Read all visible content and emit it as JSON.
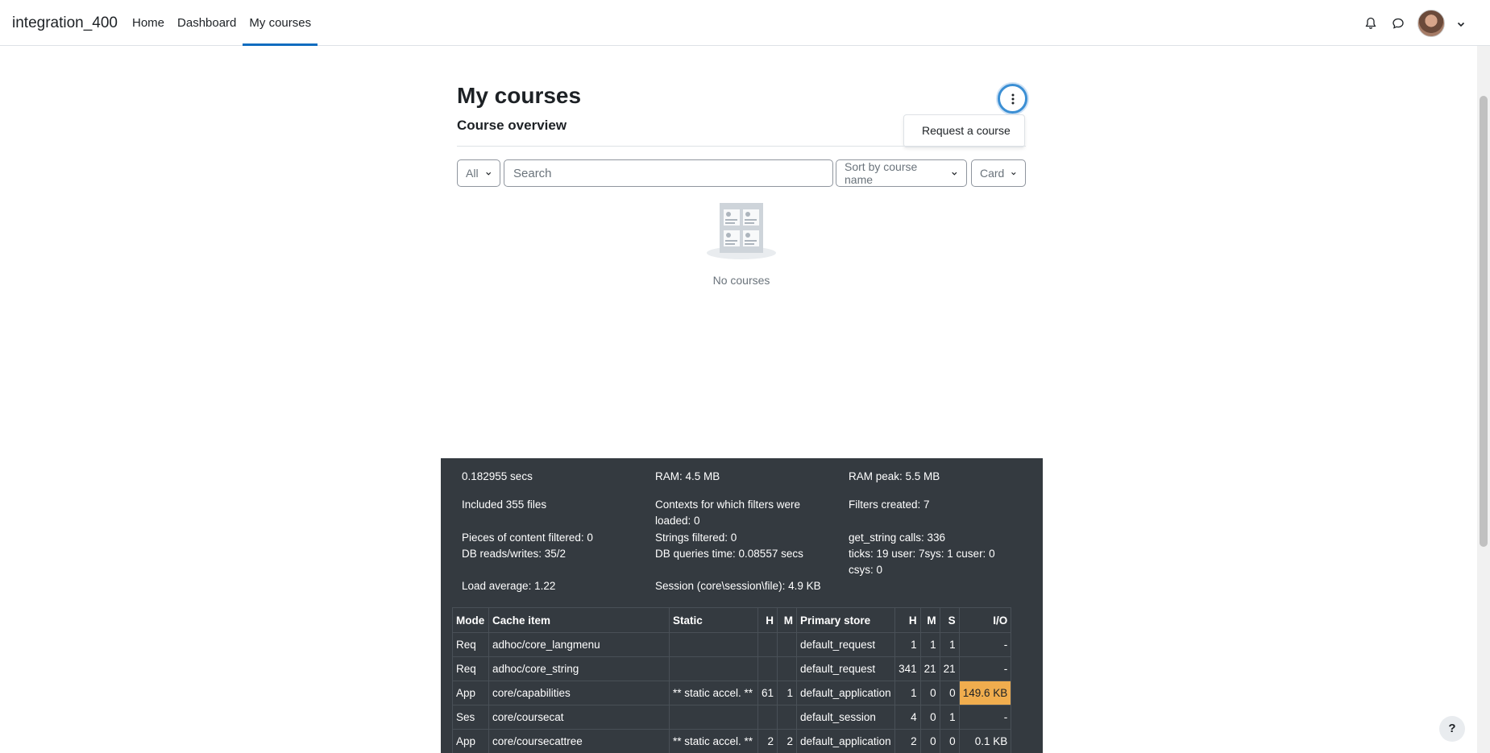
{
  "navbar": {
    "brand": "integration_400",
    "links": [
      {
        "label": "Home"
      },
      {
        "label": "Dashboard"
      },
      {
        "label": "My courses",
        "active": true
      }
    ]
  },
  "main": {
    "title": "My courses",
    "section_title": "Course overview",
    "actions_menu": {
      "item": "Request a course"
    },
    "filters": {
      "grouping": "All",
      "search_placeholder": "Search",
      "sort": "Sort by course name",
      "view": "Card"
    },
    "empty_text": "No courses"
  },
  "perf": {
    "row1": [
      "0.182955 secs",
      "RAM: 4.5 MB",
      "RAM peak: 5.5 MB"
    ],
    "included": "Included 355 files",
    "contexts": "Contexts for which filters were loaded: 0",
    "filters_created": "Filters created: 7",
    "pieces": "Pieces of content filtered: 0",
    "strings": "Strings filtered: 0",
    "get_string": "get_string calls: 336",
    "db_rw": "DB reads/writes: 35/2",
    "db_time": "DB queries time: 0.08557 secs",
    "ticks": "ticks: 19 user: 7sys: 1 cuser: 0 csys: 0",
    "load": "Load average: 1.22",
    "session": "Session (core\\session\\file): 4.9 KB"
  },
  "cache_table": {
    "headers": [
      "Mode",
      "Cache item",
      "Static",
      "H",
      "M",
      "Primary store",
      "H",
      "M",
      "S",
      "I/O"
    ],
    "rows": [
      [
        "Req",
        "adhoc/core_langmenu",
        "",
        "",
        "",
        "default_request",
        "1",
        "1",
        "1",
        "-"
      ],
      [
        "Req",
        "adhoc/core_string",
        "",
        "",
        "",
        "default_request",
        "341",
        "21",
        "21",
        "-"
      ],
      [
        "App",
        "core/capabilities",
        "** static accel. **",
        "61",
        "1",
        "default_application",
        "1",
        "0",
        "0",
        "149.6 KB"
      ],
      [
        "Ses",
        "core/coursecat",
        "",
        "",
        "",
        "default_session",
        "4",
        "0",
        "1",
        "-"
      ],
      [
        "App",
        "core/coursecattree",
        "** static accel. **",
        "2",
        "2",
        "default_application",
        "2",
        "0",
        "0",
        "0.1 KB"
      ]
    ]
  },
  "help_label": "?",
  "colors": {
    "accent": "#0f6cbf",
    "panel": "#343a40",
    "highlight": "#f0ad4e"
  }
}
